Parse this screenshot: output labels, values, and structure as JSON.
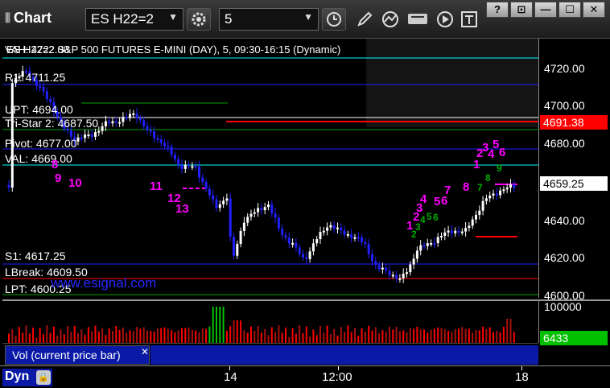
{
  "toolbar": {
    "title": "Chart",
    "symbol": "ES H22=2",
    "interval": "5",
    "window_buttons": [
      "?",
      "⊡",
      "—",
      "☐",
      "✕"
    ]
  },
  "chart": {
    "header": "ES H22=2   S&P 500 FUTURES E-MINI (DAY), 5, 09:30-16:15 (Dynamic)",
    "overlapped_header": "VAH: 4722.00",
    "levels": [
      {
        "label": "R1: 4711.25",
        "color": "#2020ff"
      },
      {
        "label": "UPT: 4694.00",
        "color": "#00a000"
      },
      {
        "label": "Tri-Star 2: 4687.50",
        "color": "#ffffff"
      },
      {
        "label": "Pivot: 4677.00",
        "color": "#2020ff"
      },
      {
        "label": "VAL: 4669.00",
        "color": "#00ffff"
      },
      {
        "label": "S1: 4617.25",
        "color": "#2020ff"
      },
      {
        "label": "LBreak: 4609.50",
        "color": "#ff0000"
      },
      {
        "label": "LPT: 4600.25",
        "color": "#00a000"
      }
    ],
    "watermark": "www.esignal.com",
    "price_ticks": [
      "4720.00",
      "4700.00",
      "4680.00",
      "4660.00",
      "4640.00",
      "4620.00",
      "4600.00"
    ],
    "current_price": "4659.25",
    "red_marker": "4691.38",
    "counts": [
      "8",
      "9",
      "10",
      "11",
      "12",
      "13",
      "1",
      "2",
      "3",
      "4",
      "5",
      "6",
      "7",
      "8",
      "1",
      "2",
      "3",
      "4",
      "5",
      "6"
    ],
    "green_counts": [
      "2",
      "3",
      "4",
      "5",
      "6",
      "7",
      "8",
      "9"
    ]
  },
  "volume": {
    "axis_label": "100000",
    "current": "6433"
  },
  "legend": {
    "item": "Vol (current price bar)",
    "close": "✕"
  },
  "time_axis": {
    "mode": "Dyn",
    "labels": [
      "14",
      "12:00",
      "18"
    ]
  },
  "colors": {
    "up_bar": "#ffffff",
    "down_bar": "#2020ff",
    "count_magenta": "#ff00ff",
    "count_green": "#00aa00",
    "price_red": "#ff0000",
    "vol_green": "#00c000"
  }
}
